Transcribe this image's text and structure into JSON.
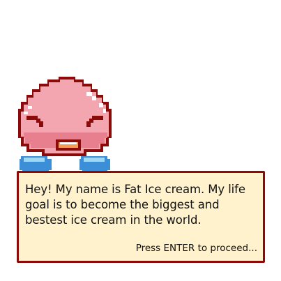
{
  "character": {
    "sprite_icon": "fat-ice-cream-sprite-icon",
    "colors": {
      "outline": "#8b0a0a",
      "body": "#f4a6b0",
      "highlight": "#ffffff",
      "shade": "#e77f8e",
      "feet": "#3c8fd6",
      "feet_light": "#9ed8f5",
      "mouth": "#f59b52"
    }
  },
  "dialog": {
    "message": "Hey! My name is Fat Ice cream.  My life goal is to become the biggest and bestest ice cream in the world.",
    "prompt": "Press ENTER to proceed...",
    "colors": {
      "background": "#fff2cc",
      "border": "#8b0a0a",
      "text": "#111111"
    }
  }
}
